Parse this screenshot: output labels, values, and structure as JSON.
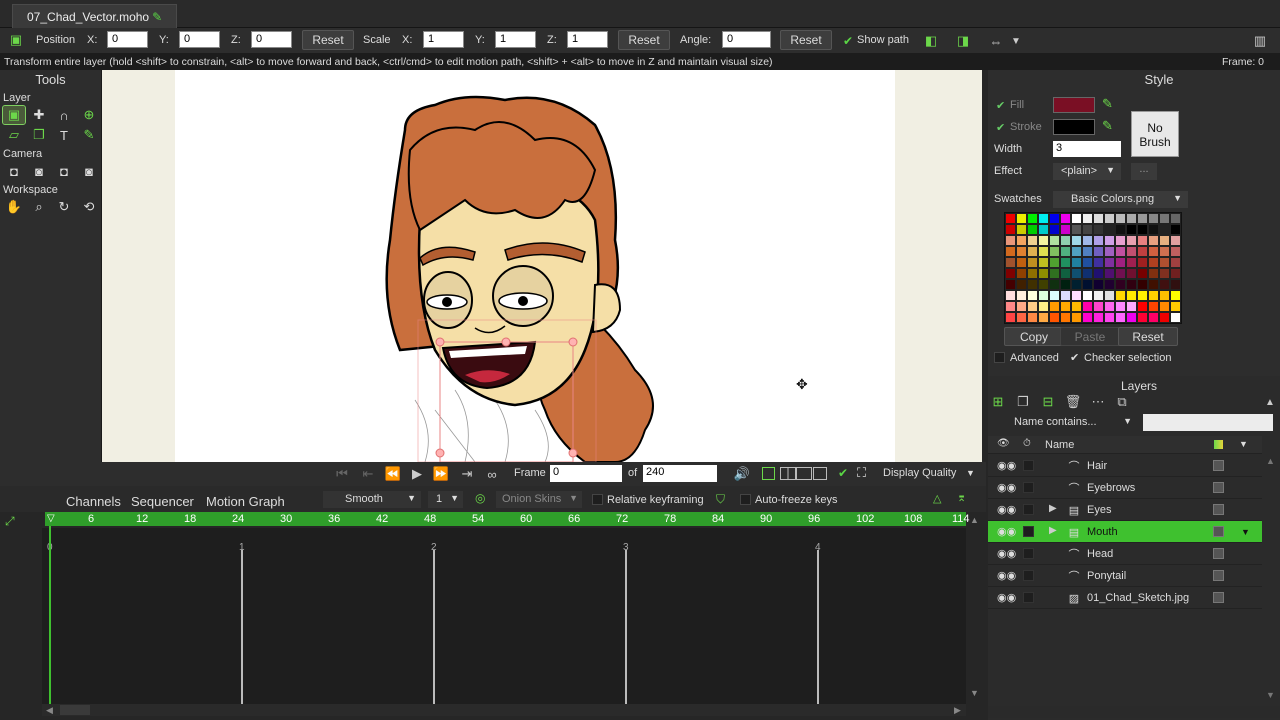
{
  "titlebar": {
    "doc_name": "07_Chad_Vector.moho",
    "edit_mark": "✎"
  },
  "toolopts": {
    "position_label": "Position",
    "x": "X:",
    "y": "Y:",
    "z": "Z:",
    "pos_x": "0",
    "pos_y": "0",
    "pos_z": "0",
    "reset1": "Reset",
    "scale_label": "Scale",
    "scale_x": "1",
    "scale_y": "1",
    "scale_z": "1",
    "reset2": "Reset",
    "angle_label": "Angle:",
    "angle": "0",
    "reset3": "Reset",
    "show_path": "Show path"
  },
  "status": {
    "text": "Transform entire layer (hold <shift> to constrain, <alt> to move forward and back, <ctrl/cmd> to edit motion path, <shift> + <alt> to move in Z and maintain visual size)",
    "frame": "Frame: 0"
  },
  "tools": {
    "title": "Tools",
    "layer": "Layer",
    "camera": "Camera",
    "workspace": "Workspace"
  },
  "style": {
    "title": "Style",
    "fill": "Fill",
    "stroke": "Stroke",
    "width_label": "Width",
    "width": "3",
    "no_brush": "No\nBrush",
    "effect_label": "Effect",
    "effect": "<plain>",
    "more": "...",
    "swatches_label": "Swatches",
    "swatches_file": "Basic Colors.png",
    "copy": "Copy",
    "paste": "Paste",
    "reset": "Reset",
    "advanced": "Advanced",
    "checker": "Checker selection",
    "fill_color": "#7a0f24",
    "stroke_color": "#000000"
  },
  "layers": {
    "title": "Layers",
    "filter": "Name contains...",
    "name_col": "Name",
    "items": [
      {
        "name": "Hair",
        "type": "vector",
        "group": false,
        "selected": false
      },
      {
        "name": "Eyebrows",
        "type": "vector",
        "group": false,
        "selected": false
      },
      {
        "name": "Eyes",
        "type": "group",
        "group": true,
        "selected": false
      },
      {
        "name": "Mouth",
        "type": "group",
        "group": true,
        "selected": true
      },
      {
        "name": "Head",
        "type": "vector",
        "group": false,
        "selected": false
      },
      {
        "name": "Ponytail",
        "type": "vector",
        "group": false,
        "selected": false
      },
      {
        "name": "01_Chad_Sketch.jpg",
        "type": "image",
        "group": false,
        "selected": false
      }
    ]
  },
  "playback": {
    "frame_label": "Frame",
    "frame": "0",
    "of": "of",
    "total": "240",
    "display_quality": "Display Quality"
  },
  "timeline": {
    "tabs": [
      "Channels",
      "Sequencer",
      "Motion Graph"
    ],
    "interp": "Smooth",
    "interp_num": "1",
    "onion": "Onion Skins",
    "relative": "Relative keyframing",
    "autofreeze": "Auto-freeze keys",
    "ruler": [
      "0",
      "6",
      "12",
      "18",
      "24",
      "30",
      "36",
      "42",
      "48",
      "54",
      "60",
      "66",
      "72",
      "78",
      "84",
      "90",
      "96",
      "102",
      "108",
      "114"
    ],
    "seconds": [
      "0",
      "1",
      "2",
      "3",
      "4"
    ]
  },
  "colors": {
    "accent": "#3fc12f",
    "hair": "#c96f3d",
    "skin": "#f5dfa7"
  }
}
